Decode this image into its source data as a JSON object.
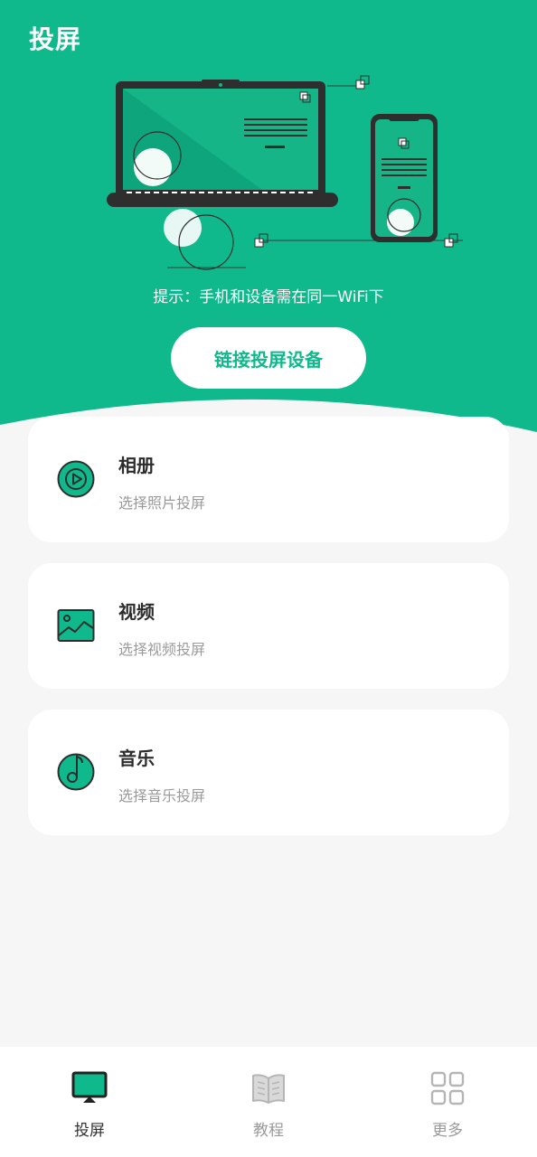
{
  "header": {
    "title": "投屏",
    "hint": "提示：手机和设备需在同一WiFi下",
    "connect_button": "链接投屏设备"
  },
  "cards": [
    {
      "title": "相册",
      "subtitle": "选择照片投屏",
      "icon": "play-circle-icon"
    },
    {
      "title": "视频",
      "subtitle": "选择视频投屏",
      "icon": "image-icon"
    },
    {
      "title": "音乐",
      "subtitle": "选择音乐投屏",
      "icon": "music-note-icon"
    }
  ],
  "nav": {
    "items": [
      {
        "label": "投屏",
        "icon": "screen-cast-icon",
        "active": true
      },
      {
        "label": "教程",
        "icon": "book-icon",
        "active": false
      },
      {
        "label": "更多",
        "icon": "grid-icon",
        "active": false
      }
    ]
  },
  "colors": {
    "accent": "#0fb98b",
    "dark": "#2e2e2e",
    "background": "#f6f6f6",
    "inactive": "#9a9a9a",
    "active_label": "#333333"
  }
}
